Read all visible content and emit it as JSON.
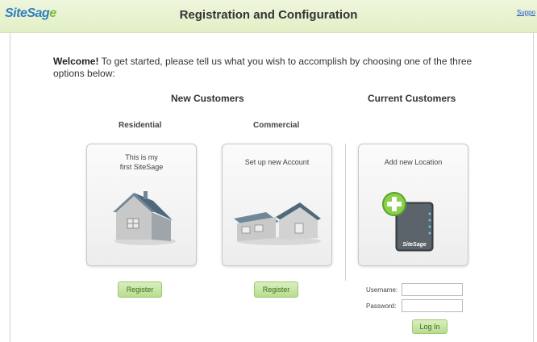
{
  "header": {
    "logo": "SiteSag",
    "logo_mark": "e",
    "title": "Registration and Configuration",
    "support_link": "Suppo"
  },
  "welcome": {
    "lead": "Welcome!",
    "text": " To get started, please tell us what you wish to accomplish by choosing one of the three options below:"
  },
  "new_customers": {
    "heading": "New Customers",
    "residential": {
      "label": "Residential",
      "card_line1": "This is my",
      "card_line2": "first SiteSage",
      "button": "Register"
    },
    "commercial": {
      "label": "Commercial",
      "card_text": "Set up new Account",
      "button": "Register"
    }
  },
  "current_customers": {
    "heading": "Current Customers",
    "card_text": "Add new Location",
    "device_label": "SiteSage",
    "username_label": "Username:",
    "password_label": "Password:",
    "login_button": "Log In"
  },
  "icons": {
    "residential": "house-icon",
    "commercial": "building-icon",
    "location": "device-add-icon"
  },
  "colors": {
    "accent_blue": "#2f7fbf",
    "accent_green": "#7fb83a",
    "button_bg": "#c6e4a4"
  }
}
